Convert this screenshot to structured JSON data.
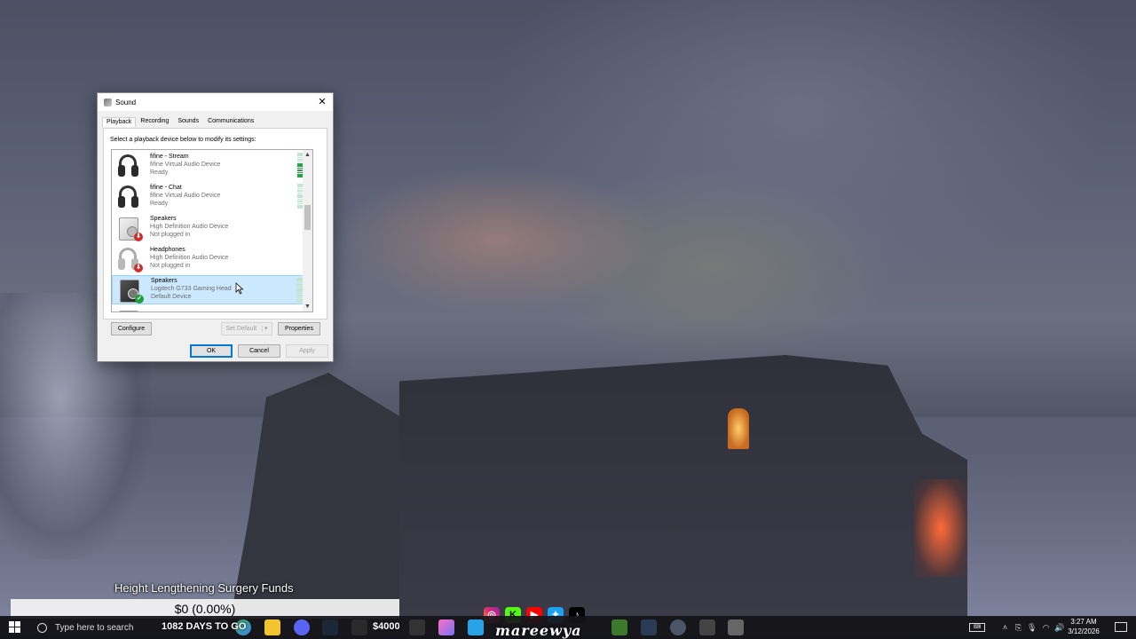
{
  "dialog": {
    "title": "Sound",
    "tabs": [
      "Playback",
      "Recording",
      "Sounds",
      "Communications"
    ],
    "active_tab": "Playback",
    "hint": "Select a playback device below to modify its settings:",
    "devices": [
      {
        "name": "fifine - Stream",
        "desc": "fifine Virtual Audio Device",
        "status": "Ready",
        "icon": "headphones-icon",
        "level": 0.6
      },
      {
        "name": "fifine - Chat",
        "desc": "fifine Virtual Audio Device",
        "status": "Ready",
        "icon": "headphones-icon",
        "level": 0
      },
      {
        "name": "Speakers",
        "desc": "High Definition Audio Device",
        "status": "Not plugged in",
        "icon": "speaker-icon",
        "badge": "unplugged"
      },
      {
        "name": "Headphones",
        "desc": "High Definition Audio Device",
        "status": "Not plugged in",
        "icon": "headphones-icon",
        "badge": "unplugged"
      },
      {
        "name": "Speakers",
        "desc": "Logitech G733 Gaming Head",
        "status": "Default Device",
        "icon": "speaker-icon",
        "badge": "default",
        "level": 0,
        "selected": true
      }
    ],
    "buttons": {
      "configure": "Configure",
      "set_default": "Set Default",
      "properties": "Properties",
      "ok": "OK",
      "cancel": "Cancel",
      "apply": "Apply"
    },
    "colors": {
      "accent": "#0078d7",
      "selection": "#cce8ff",
      "meter": "#27a04a",
      "unplugged_badge": "#d32b2b",
      "default_badge": "#1e9e3a"
    }
  },
  "overlay": {
    "goal_title": "Height Lengthening Surgery Funds",
    "goal_amount": "$0 (0.00%)",
    "goal_progress": 0,
    "ticker": "1082 DAYS TO GO",
    "price": "$4000",
    "brand": "mareewya",
    "socials": [
      "instagram-icon",
      "kick-icon",
      "youtube-icon",
      "twitter-icon",
      "tiktok-icon"
    ]
  },
  "taskbar": {
    "search_placeholder": "Type here to search",
    "time": "3:27 AM",
    "date": "3/12/2026"
  }
}
